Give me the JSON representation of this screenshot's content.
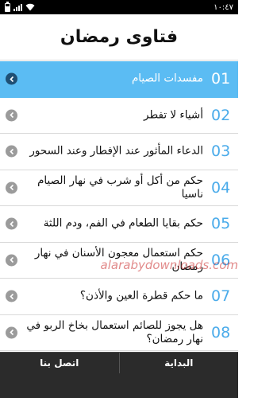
{
  "status_bar": {
    "time": "١٠:٤٧",
    "icons": [
      "battery-icon",
      "signal-icon",
      "wifi-icon"
    ]
  },
  "header": {
    "title": "فتاوى رمضان"
  },
  "list": {
    "items": [
      {
        "number": "01",
        "label": "مفسدات الصيام",
        "selected": true
      },
      {
        "number": "02",
        "label": "أشياء لا تفطر",
        "selected": false
      },
      {
        "number": "03",
        "label": "الدعاء المأثور عند الإفطار وعند السحور",
        "selected": false
      },
      {
        "number": "04",
        "label": "حكم من أكل أو شرب في نهار الصيام ناسيا",
        "selected": false
      },
      {
        "number": "05",
        "label": "حكم بقايا الطعام في الفم، ودم اللثة",
        "selected": false
      },
      {
        "number": "06",
        "label": "حكم استعمال معجون الأسنان في نهار رمضان",
        "selected": false
      },
      {
        "number": "07",
        "label": "ما حكم قطرة العين والأذن؟",
        "selected": false
      },
      {
        "number": "08",
        "label": "هل يجوز للصائم استعمال بخاخ الربو في نهار رمضان؟",
        "selected": false
      }
    ]
  },
  "watermark": "alarabydownloads.com",
  "bottom_nav": {
    "home_label": "البداية",
    "contact_label": "اتصل بنا"
  },
  "colors": {
    "accent": "#4aabea",
    "selected_row": "#5bbcf3",
    "bottom_bar": "#2b2b2b"
  }
}
